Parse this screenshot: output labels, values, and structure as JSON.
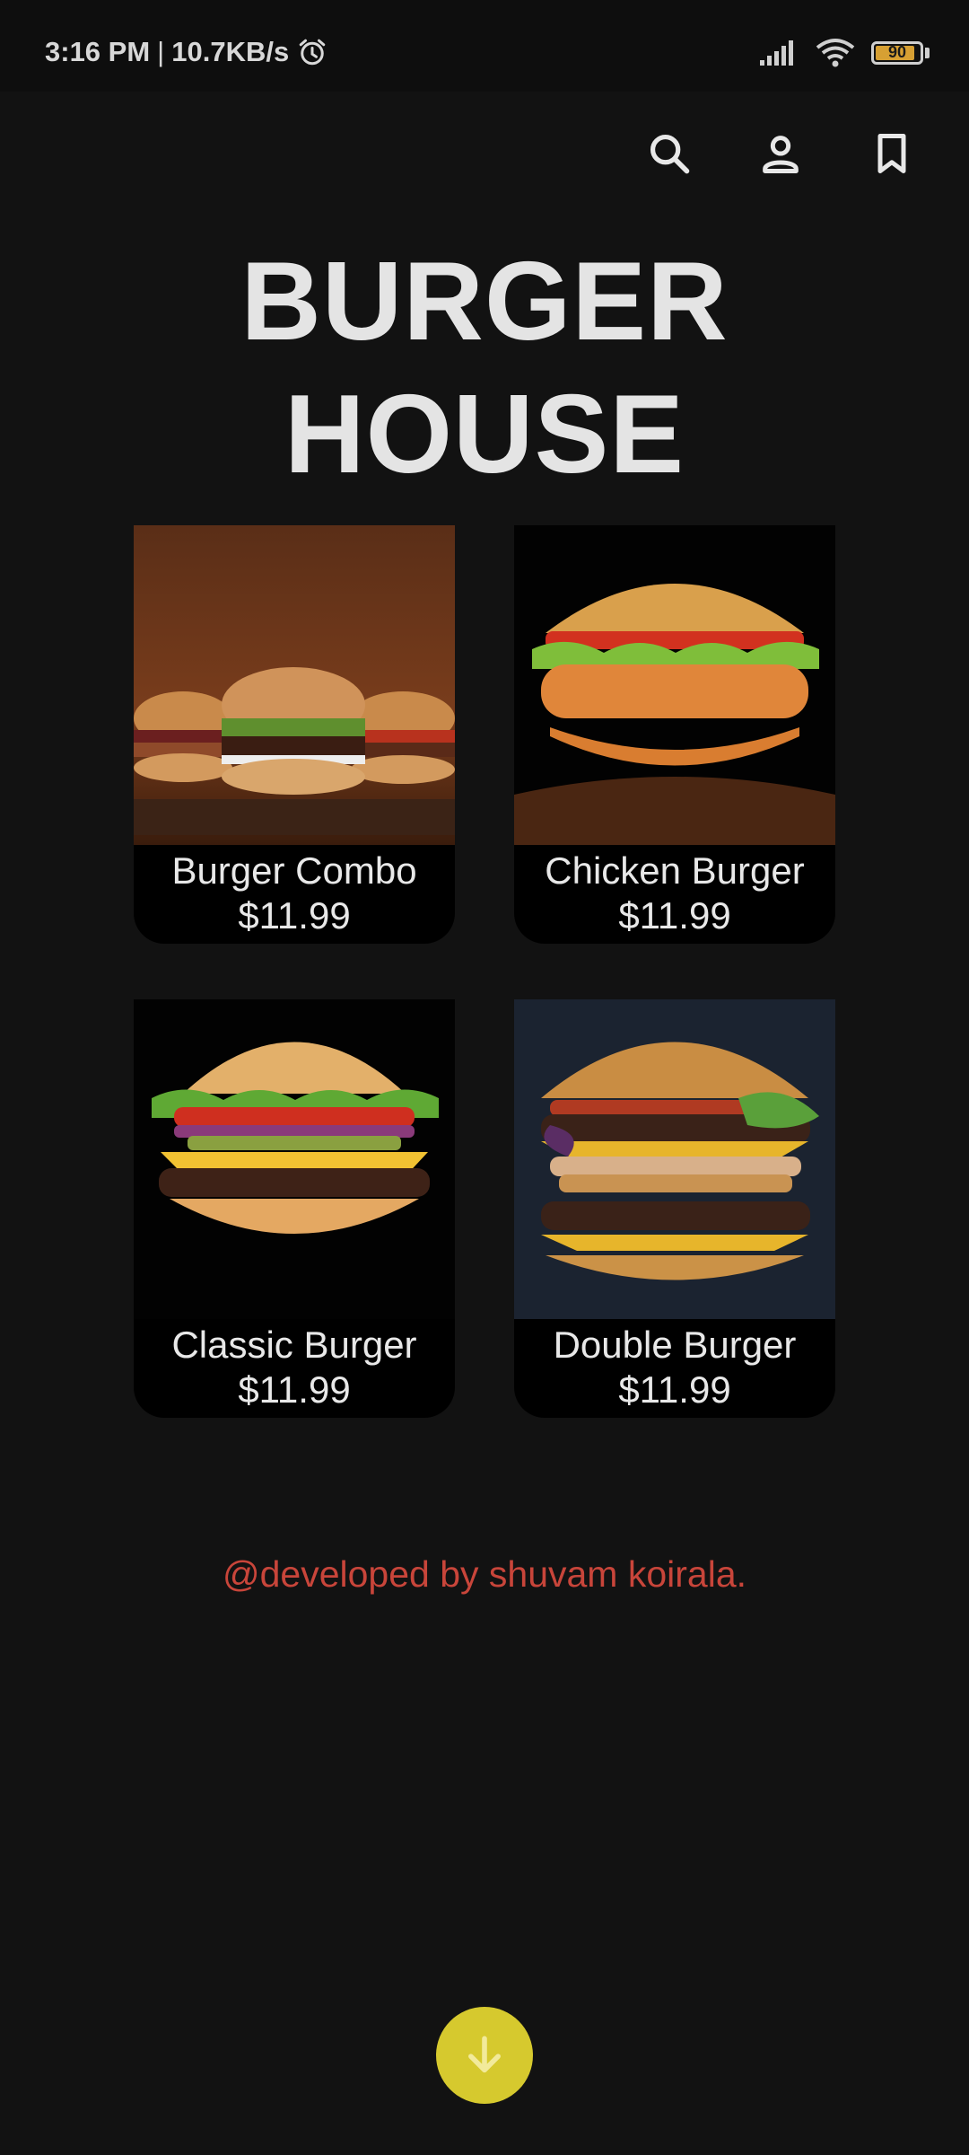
{
  "status_bar": {
    "time": "3:16 PM",
    "separator": "|",
    "network_speed": "10.7KB/s",
    "battery_level": "90",
    "battery_fraction": 0.9,
    "icons": [
      "alarm-icon",
      "signal-icon",
      "wifi-icon",
      "battery-icon"
    ]
  },
  "header": {
    "actions": [
      "search-icon",
      "profile-icon",
      "bookmark-icon"
    ]
  },
  "title": {
    "line1": "BURGER",
    "line2": "HOUSE"
  },
  "menu_items": [
    {
      "name": "Burger Combo",
      "price": "$11.99"
    },
    {
      "name": "Chicken Burger",
      "price": "$11.99"
    },
    {
      "name": "Classic Burger",
      "price": "$11.99"
    },
    {
      "name": "Double Burger",
      "price": "$11.99"
    }
  ],
  "footer": {
    "credit": "@developed by shuvam koirala."
  },
  "fab": {
    "icon": "arrow-down-icon"
  },
  "colors": {
    "background": "#121212",
    "accent_yellow": "#d6c92e",
    "credit_red": "#c8453a",
    "text": "#e6e6e6"
  }
}
